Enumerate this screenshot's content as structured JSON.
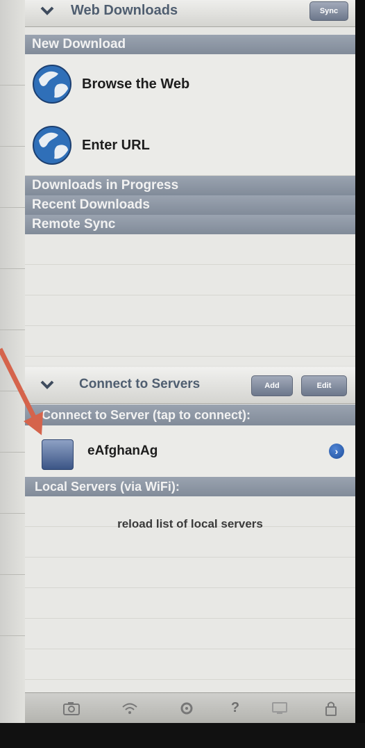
{
  "header": {
    "title": "Web Downloads",
    "sync_label": "Sync"
  },
  "sections": {
    "new_download": "New Download",
    "in_progress": "Downloads in Progress",
    "recent": "Recent Downloads",
    "remote_sync": "Remote Sync",
    "connect_server": "Connect to Server (tap to connect):",
    "local_servers": "Local Servers (via WiFi):"
  },
  "new_download_items": [
    {
      "label": "Browse the Web",
      "icon": "globe-icon"
    },
    {
      "label": "Enter URL",
      "icon": "globe-icon"
    }
  ],
  "servers_header": {
    "title": "Connect to Servers",
    "add_label": "Add",
    "edit_label": "Edit"
  },
  "server_item": {
    "label": "eAfghanAg",
    "icon": "drive-icon"
  },
  "local": {
    "reload_label": "reload list of local servers"
  },
  "toolbar": {
    "icons": [
      "camera-icon",
      "wifi-icon",
      "gear-icon",
      "help-icon",
      "monitor-icon",
      "lock-icon"
    ],
    "help_glyph": "?"
  },
  "colors": {
    "accent": "#5b6a80",
    "section": "#8b95a3",
    "arrow": "#d5644c"
  }
}
